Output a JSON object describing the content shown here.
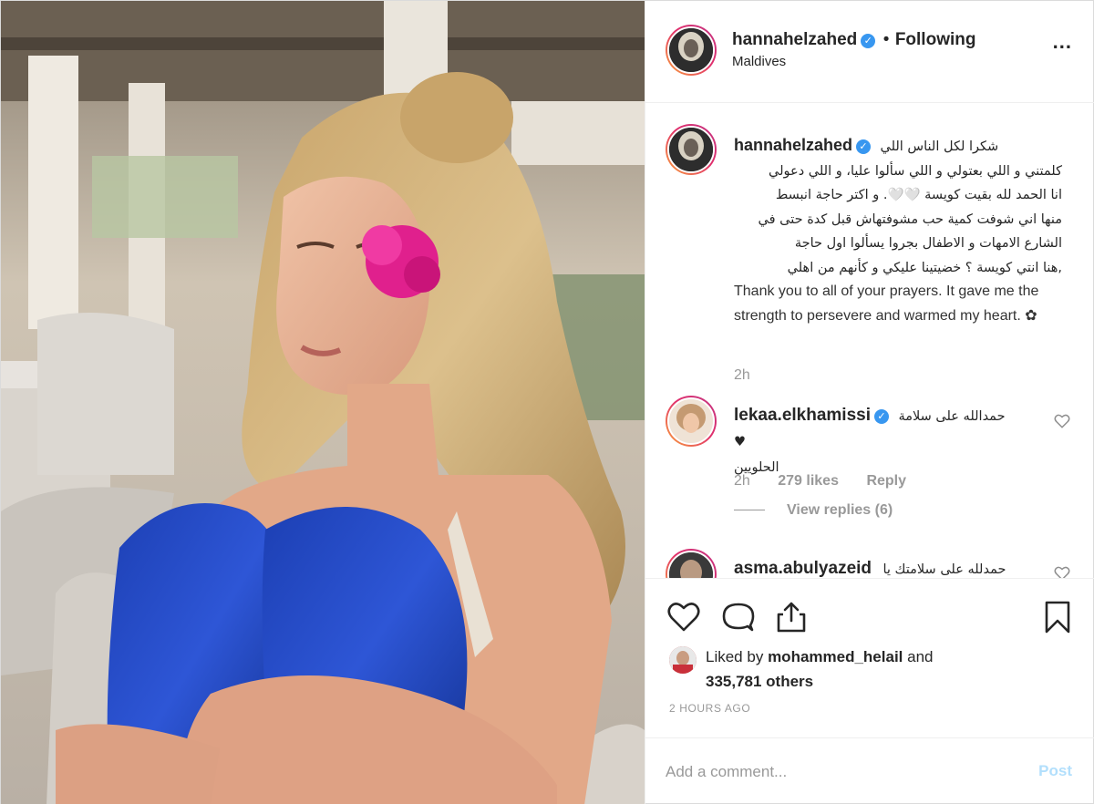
{
  "header": {
    "username": "hannahelzahed",
    "separator": "•",
    "following_label": "Following",
    "location": "Maldives",
    "more_label": "..."
  },
  "caption": {
    "username": "hannahelzahed",
    "arabic_line1": "شكرا لكل الناس اللي",
    "arabic_lines": [
      "كلمتني و اللي بعتولي و اللي سألوا عليا، و اللي دعولي",
      "انا الحمد لله بقيت كويسة 🤍🤍. و اكتر حاجة انبسط",
      "منها اني شوفت كمية حب مشوفتهاش قبل كدة حتى في",
      "الشارع الامهات و الاطفال بجروا يسألوا اول حاجة",
      ",هنا انتي كويسة ؟ خضيتينا عليكي و كأنهم من اهلي"
    ],
    "english": "Thank you to all of your prayers. It gave me the strength to persevere and warmed my heart. ✿",
    "timestamp": "2h"
  },
  "comments": [
    {
      "username": "lekaa.elkhamissi",
      "text_line1": "حمدالله على سلامة",
      "text_line2": "♥ الحلويين",
      "time": "2h",
      "likes": "279 likes",
      "reply_label": "Reply",
      "view_replies": "View replies (6)"
    },
    {
      "username": "asma.abulyazeid",
      "text_line1": "حمدلله على سلامتك يا"
    }
  ],
  "likes": {
    "prefix": "Liked by",
    "liker": "mohammed_helail",
    "and_label": "and",
    "others": "335,781 others"
  },
  "posted_time": "2 HOURS AGO",
  "add_comment": {
    "placeholder": "Add a comment...",
    "post_label": "Post"
  },
  "icons": [
    "like-heart-icon",
    "comment-icon",
    "share-icon",
    "bookmark-icon",
    "verified-badge-icon",
    "more-options-icon"
  ],
  "colors": {
    "verified_blue": "#3897f0",
    "post_button_disabled": "#b2dffc",
    "secondary_text": "#999999",
    "primary_text": "#262626"
  }
}
